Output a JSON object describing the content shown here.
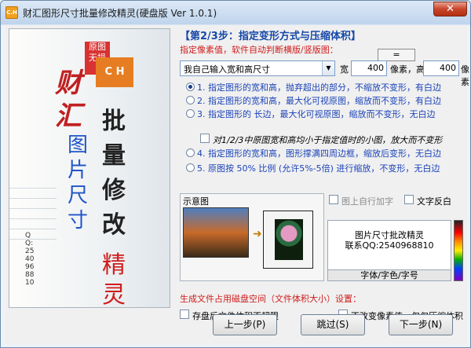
{
  "window": {
    "title": "财汇图形尺寸批量修改精灵(硬盘版 Ver 1.0.1)",
    "icon_text": "C.H",
    "close_label": "✕"
  },
  "poster": {
    "corner": "原图无损",
    "ch": "C H",
    "brand": "财汇",
    "word_pic": "图片尺寸",
    "word_batch": "批量修改",
    "word_sprite": "精灵",
    "qq": "QQ:2540968810"
  },
  "step": {
    "title": "【第2/3步：指定变形方式与压缩体积】",
    "hint": "指定像素值，软件自动判断横版/竖版图：",
    "equal_button": "="
  },
  "size": {
    "select_value": "我自己输入宽和高尺寸",
    "width_label": "宽",
    "width_value": "400",
    "width_unit": "像素，高",
    "height_value": "400",
    "height_unit": "像素"
  },
  "options": [
    {
      "label": "1. 指定图形的宽和高，抛弃超出的部分，不缩放不变形，有白边",
      "selected": true
    },
    {
      "label": "2. 指定图形的宽和高，最大化可视原图，缩放而不变形，有白边",
      "selected": false
    },
    {
      "label": "3. 指定图形的 长边，最大化可视原图，缩放而不变形，无白边",
      "selected": false
    }
  ],
  "small_image_option": "对1/2/3中原图宽和高均小于指定值时的小图，放大而不变形",
  "options2": [
    {
      "label": "4. 指定图形的宽和高，图形撑满四周边框，缩放后变形，无白边",
      "selected": false
    },
    {
      "label": "5. 原图按    50%    比例 (允许5%-5倍) 进行缩放，不变形，无白边",
      "selected": false
    }
  ],
  "preview": {
    "label": "示意图",
    "watermark_option": "图上自行加字",
    "text_invert_option": "文字反白",
    "watermark_text_line1": "图片尺寸批改精灵",
    "watermark_text_line2": "联系QQ:2540968810",
    "font_button": "字体/字色/字号"
  },
  "disk": {
    "section_title": "生成文件占用磁盘空间（文件体积大小）设置：",
    "no_limit_option": "存盘后文件体积不超限",
    "compress_option": "不改变像素值，仅仅压缩体积"
  },
  "nav": {
    "prev": "上一步(P)",
    "skip": "跳过(S)",
    "next": "下一步(N)"
  }
}
